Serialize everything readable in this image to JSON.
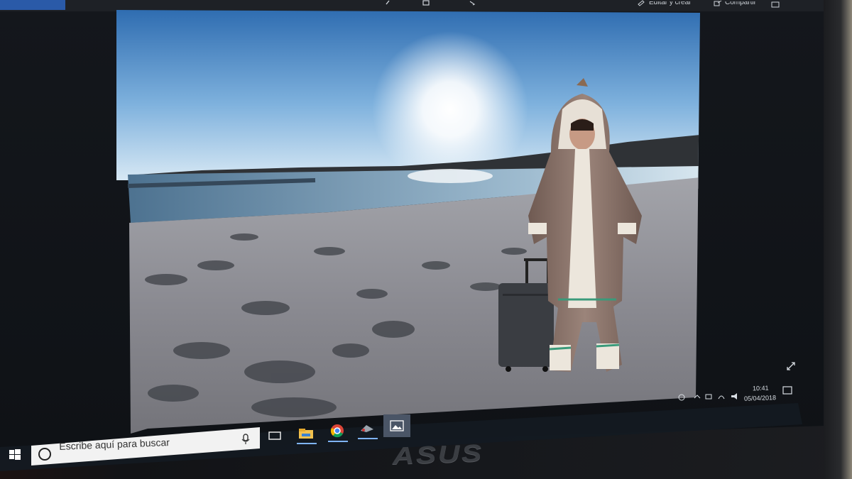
{
  "toolbar": {
    "edit_label": "Editar y crear",
    "share_label": "Compartir"
  },
  "taskbar": {
    "search_placeholder": "Escribe aquí para buscar",
    "apps": [
      "task-view",
      "file-explorer",
      "chrome",
      "snipping-tool",
      "photos"
    ]
  },
  "tray": {
    "time": "10:41",
    "date": "05/04/2018"
  },
  "brand": {
    "logo_text": "ASUS"
  },
  "colors": {
    "sky_top": "#3f7fc2",
    "sky_bottom": "#cfe3f2",
    "sea": "#4a6f8a",
    "sand": "#8a8d96",
    "taskbar": "#141a22",
    "accent": "#2a5aa8"
  }
}
